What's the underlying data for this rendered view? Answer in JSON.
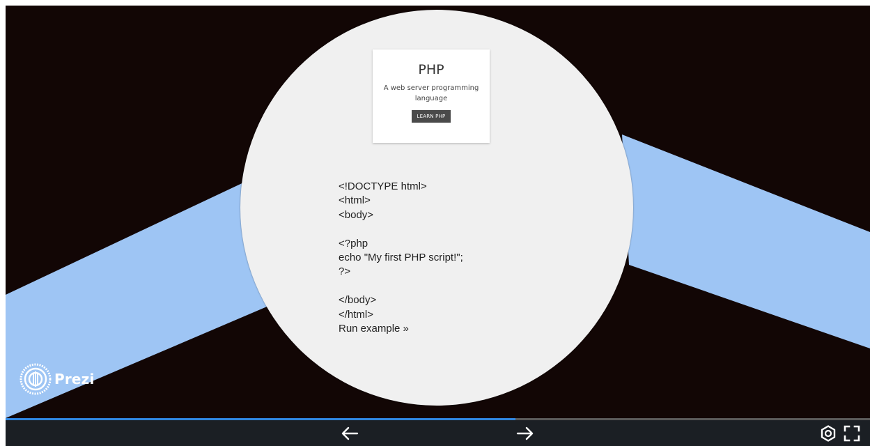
{
  "slide": {
    "card": {
      "title": "PHP",
      "subtitle": "A web server programming language",
      "button_label": "LEARN PHP"
    },
    "code_lines": [
      "<!DOCTYPE html>",
      "<html>",
      "<body>",
      "",
      "<?php",
      "echo \"My first PHP script!\";",
      "?>",
      "",
      "</body>",
      "</html>"
    ],
    "run_link": "Run example »"
  },
  "branding": {
    "logo_text": "Prezi"
  },
  "player": {
    "progress": 0.59,
    "prev_icon": "arrow-left-icon",
    "next_icon": "arrow-right-icon",
    "settings_icon": "gear-icon",
    "fullscreen_icon": "fullscreen-icon"
  },
  "colors": {
    "background": "#120605",
    "band": "#9ec5f4",
    "circle": "#f0f0f0",
    "progress": "#2f86e0",
    "bar": "#1b1f24"
  }
}
